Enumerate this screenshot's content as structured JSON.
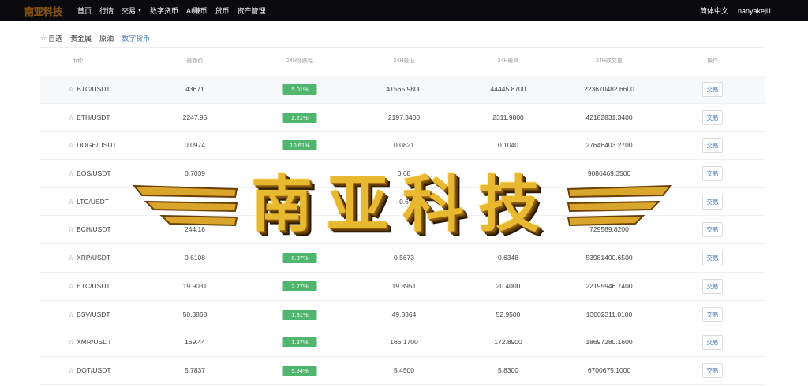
{
  "brand": {
    "logo_text": "南亚科技",
    "watermark_text": "南亚科技"
  },
  "nav": {
    "items": [
      {
        "label": "首页"
      },
      {
        "label": "行情"
      },
      {
        "label": "交易",
        "dropdown": true
      },
      {
        "label": "数字货币"
      },
      {
        "label": "AI赚币"
      },
      {
        "label": "贷币"
      },
      {
        "label": "资产管理"
      }
    ],
    "language": "简体中文",
    "username": "nanyakeji1"
  },
  "tabs": [
    {
      "label": "自选",
      "icon": "star-icon"
    },
    {
      "label": "贵金属"
    },
    {
      "label": "原油"
    },
    {
      "label": "数字货币",
      "active": true
    }
  ],
  "table": {
    "headers": [
      "币种",
      "最新价",
      "24H涨跌幅",
      "24H最低",
      "24H最高",
      "24H成交量",
      "操作"
    ],
    "action_label": "交易",
    "rows": [
      {
        "pair": "BTC/USDT",
        "price": "43671",
        "change": "5.01%",
        "low": "41565.9800",
        "high": "44445.8700",
        "volume": "223670482.6600"
      },
      {
        "pair": "ETH/USDT",
        "price": "2247.95",
        "change": "2.21%",
        "low": "2197.3400",
        "high": "2311.9800",
        "volume": "42182831.3400"
      },
      {
        "pair": "DOGE/USDT",
        "price": "0.0974",
        "change": "10.61%",
        "low": "0.0821",
        "high": "0.1040",
        "volume": "27646403.2700"
      },
      {
        "pair": "EOS/USDT",
        "price": "0.7039",
        "change": "",
        "low": "0.68",
        "high": "",
        "volume": "9086469.3500"
      },
      {
        "pair": "LTC/USDT",
        "price": "",
        "change": "",
        "low": "0.6",
        "high": "",
        "volume": ""
      },
      {
        "pair": "BCH/USDT",
        "price": "244.18",
        "change": "",
        "low": "",
        "high": "",
        "volume": "729589.8200"
      },
      {
        "pair": "XRP/USDT",
        "price": "0.6108",
        "change": "0.87%",
        "low": "0.5673",
        "high": "0.6348",
        "volume": "53981400.6500"
      },
      {
        "pair": "ETC/USDT",
        "price": "19.9031",
        "change": "2.27%",
        "low": "19.3951",
        "high": "20.4000",
        "volume": "22195946.7400"
      },
      {
        "pair": "BSV/USDT",
        "price": "50.3868",
        "change": "1.81%",
        "low": "49.3364",
        "high": "52.9500",
        "volume": "13002311.0100"
      },
      {
        "pair": "XMR/USDT",
        "price": "169.44",
        "change": "1.87%",
        "low": "166.1700",
        "high": "172.8900",
        "volume": "18697280.1600"
      },
      {
        "pair": "DOT/USDT",
        "price": "5.7837",
        "change": "5.34%",
        "low": "5.4500",
        "high": "5.8300",
        "volume": "6700675.1000"
      }
    ]
  },
  "colors": {
    "topbar": "#0b0b0f",
    "accent": "#4a7fbf",
    "positive": "#4fb56f",
    "watermark_gold": "#e8b830"
  }
}
